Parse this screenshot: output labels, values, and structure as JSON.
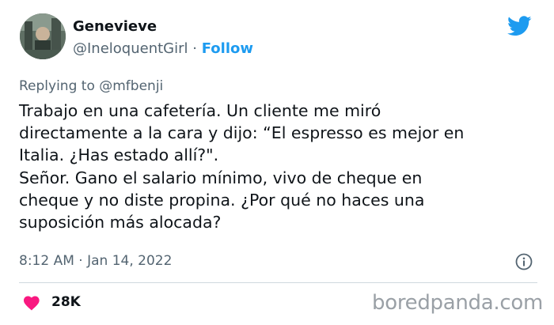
{
  "user": {
    "display_name": "Genevieve",
    "handle": "@IneloquentGirl",
    "separator": "·",
    "follow_label": "Follow"
  },
  "reply": {
    "prefix": "Replying to",
    "target": "@mfbenji"
  },
  "tweet": {
    "lines": [
      "Trabajo en una cafetería. Un cliente me miró",
      "directamente a la cara y dijo: “El espresso es mejor en",
      "Italia. ¿Has estado allí?\".",
      "Señor. Gano el salario mínimo, vivo de cheque en",
      "cheque y no diste propina. ¿Por qué no haces una",
      "suposición más alocada?"
    ],
    "timestamp": "8:12 AM · Jan 14, 2022"
  },
  "stats": {
    "likes": "28K"
  },
  "watermark": "boredpanda.com",
  "icons": {
    "platform": "twitter-bird-icon",
    "info": "info-icon",
    "like": "heart-icon"
  },
  "colors": {
    "accent": "#1d9bf0",
    "heart": "#f91880",
    "muted_text": "#536471",
    "main_text": "#0f1419"
  }
}
